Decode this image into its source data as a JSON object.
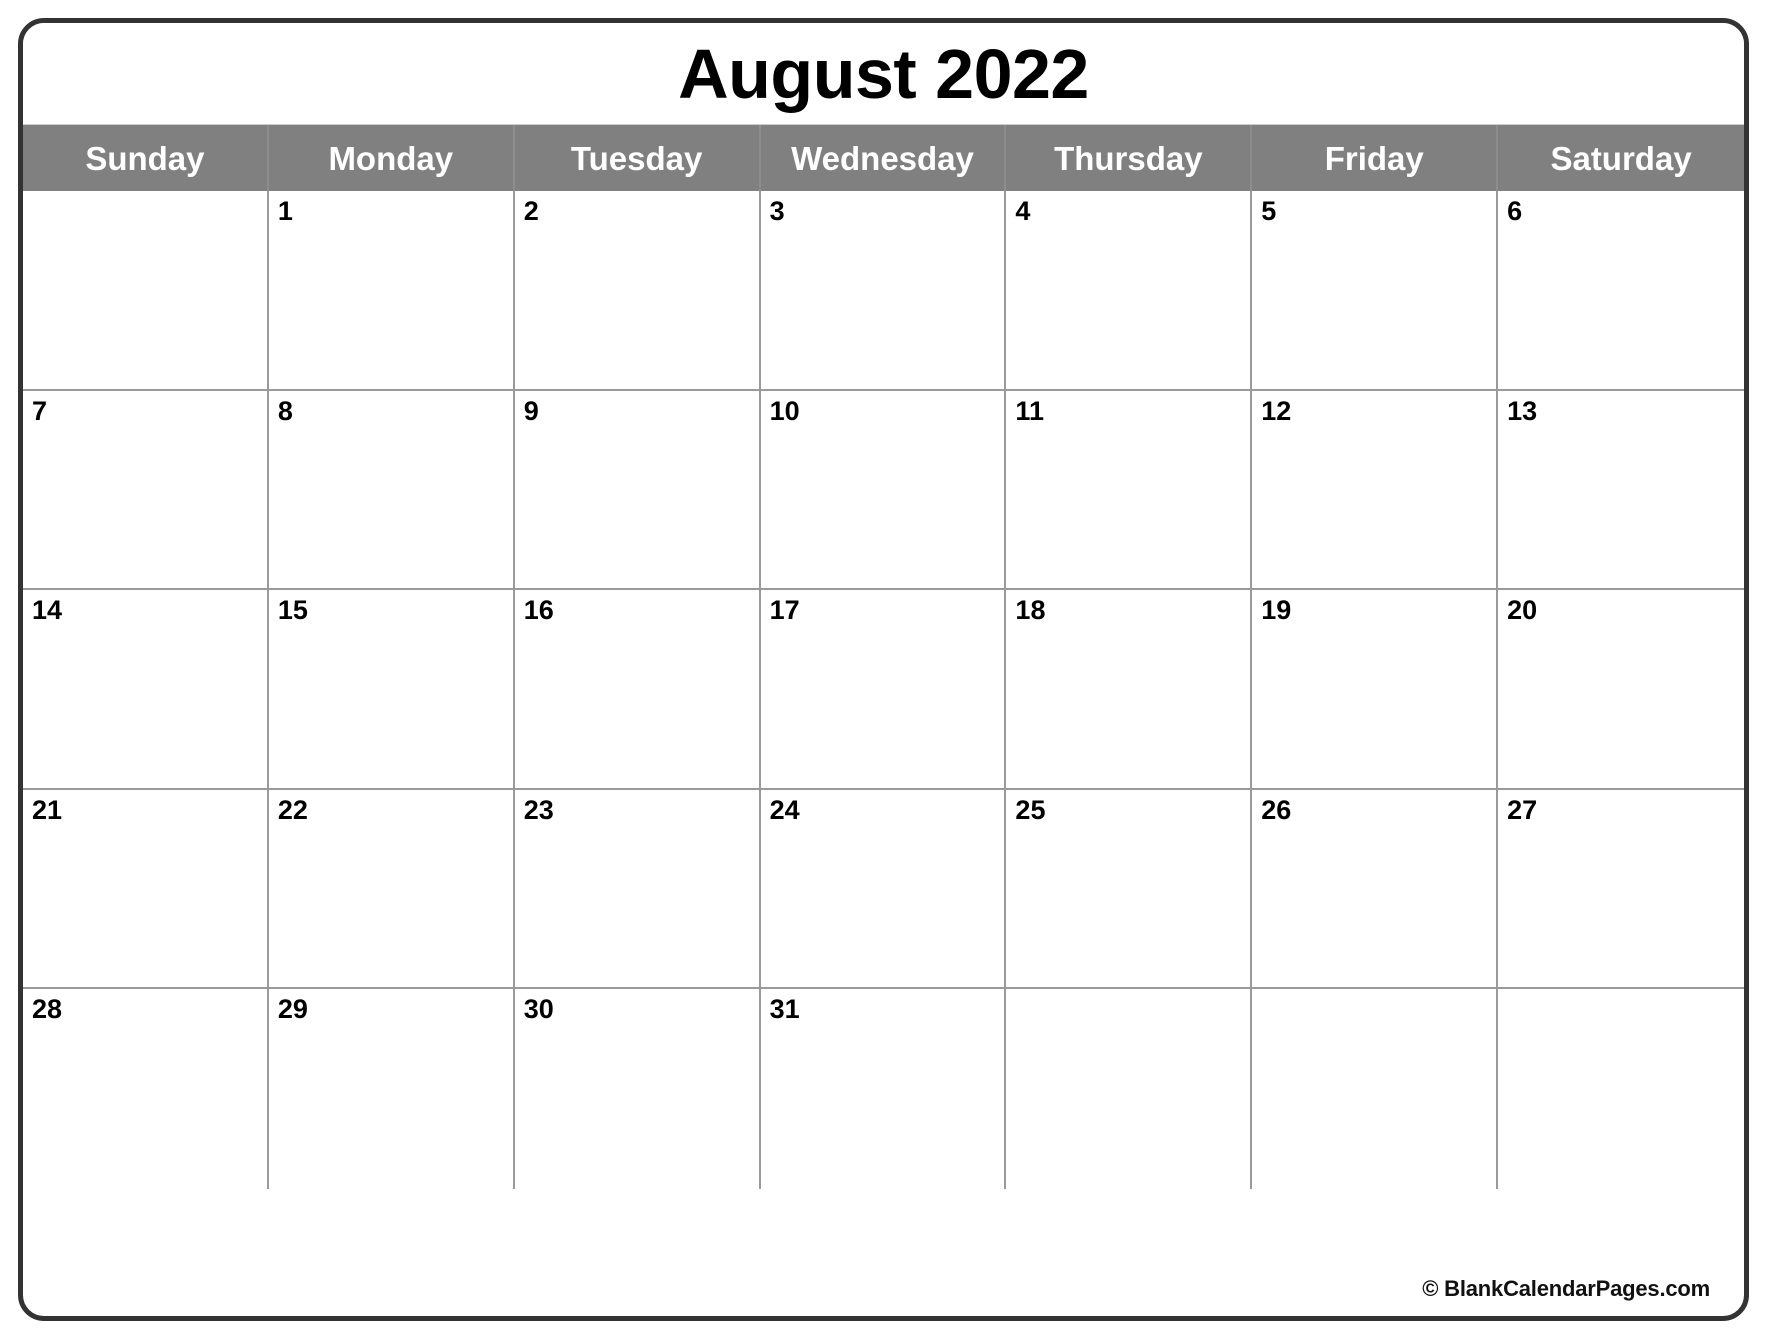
{
  "page": {
    "month_title": "August 2022",
    "credit": "© BlankCalendarPages.com"
  },
  "colors": {
    "header_background": "#808080",
    "header_text": "#ffffff",
    "frame_border": "#333333",
    "grid_line": "#9a9a9a",
    "day_number": "#000000",
    "page_background": "#ffffff"
  },
  "weekdays": [
    {
      "label": "Sunday"
    },
    {
      "label": "Monday"
    },
    {
      "label": "Tuesday"
    },
    {
      "label": "Wednesday"
    },
    {
      "label": "Thursday"
    },
    {
      "label": "Friday"
    },
    {
      "label": "Saturday"
    }
  ],
  "weeks": [
    [
      {
        "day": ""
      },
      {
        "day": "1"
      },
      {
        "day": "2"
      },
      {
        "day": "3"
      },
      {
        "day": "4"
      },
      {
        "day": "5"
      },
      {
        "day": "6"
      }
    ],
    [
      {
        "day": "7"
      },
      {
        "day": "8"
      },
      {
        "day": "9"
      },
      {
        "day": "10"
      },
      {
        "day": "11"
      },
      {
        "day": "12"
      },
      {
        "day": "13"
      }
    ],
    [
      {
        "day": "14"
      },
      {
        "day": "15"
      },
      {
        "day": "16"
      },
      {
        "day": "17"
      },
      {
        "day": "18"
      },
      {
        "day": "19"
      },
      {
        "day": "20"
      }
    ],
    [
      {
        "day": "21"
      },
      {
        "day": "22"
      },
      {
        "day": "23"
      },
      {
        "day": "24"
      },
      {
        "day": "25"
      },
      {
        "day": "26"
      },
      {
        "day": "27"
      }
    ],
    [
      {
        "day": "28"
      },
      {
        "day": "29"
      },
      {
        "day": "30"
      },
      {
        "day": "31"
      },
      {
        "day": ""
      },
      {
        "day": ""
      },
      {
        "day": ""
      }
    ]
  ]
}
